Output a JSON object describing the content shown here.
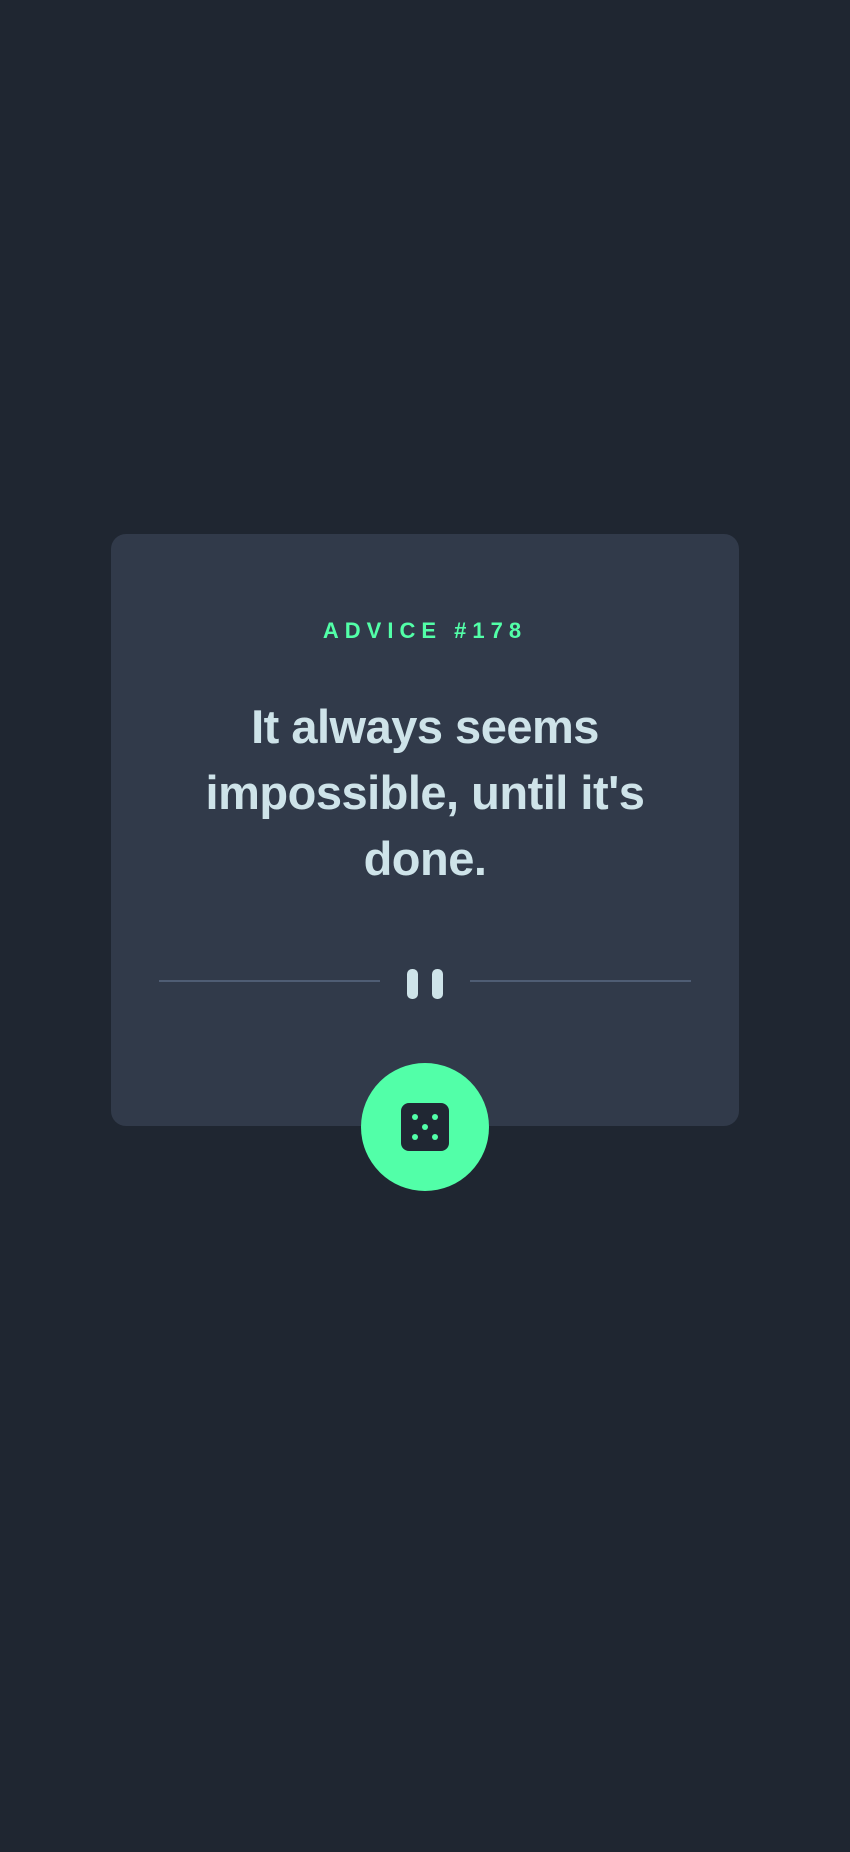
{
  "advice": {
    "id_label": "ADVICE #178",
    "quote": "It always seems impossible, until it's done."
  },
  "icons": {
    "divider": "pause-icon",
    "button": "dice-icon"
  },
  "colors": {
    "background": "#1f2631",
    "card": "#313a4a",
    "accent": "#52ffa8",
    "text": "#cee3e9",
    "divider": "#4f5d74"
  }
}
